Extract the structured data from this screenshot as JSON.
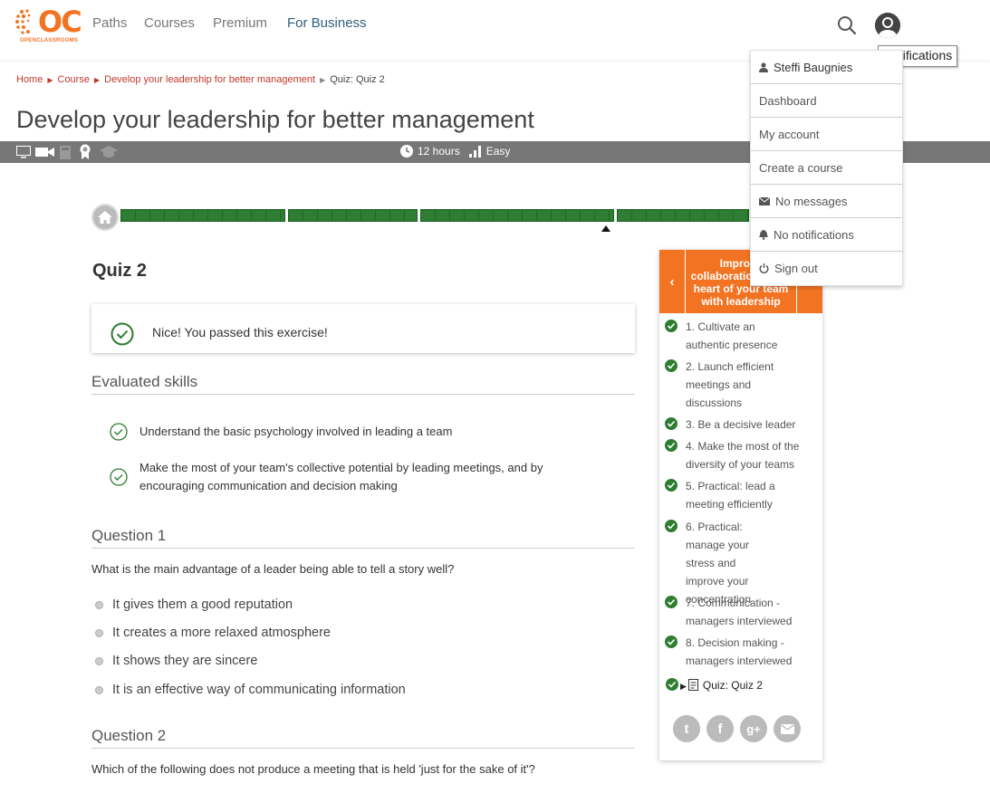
{
  "header": {
    "logo_text": "OC",
    "logo_subtext": "OPENCLASSROOMS",
    "nav": [
      "Paths",
      "Courses",
      "Premium",
      "For Business"
    ],
    "tooltip": "Notifications"
  },
  "user_menu": {
    "user_name": "Steffi Baugnies",
    "items": [
      "Dashboard",
      "My account",
      "Create a course",
      "No messages",
      "No notifications",
      "Sign out"
    ]
  },
  "breadcrumb": [
    "Home",
    "Course",
    "Develop your leadership for better management",
    "Quiz: Quiz 2"
  ],
  "course": {
    "title": "Develop your leadership for better management",
    "duration": "12 hours",
    "difficulty": "Easy"
  },
  "progress": {
    "segments": 4,
    "complete_fraction": 1.0
  },
  "quiz": {
    "title": "Quiz 2",
    "passed_message": "Nice! You passed this exercise!",
    "skills_heading": "Evaluated skills",
    "skills": [
      "Understand the basic psychology involved in leading a team",
      "Make the most of your team's collective potential by leading meetings, and by encouraging communication and decision making"
    ],
    "questions": [
      {
        "heading": "Question 1",
        "text": "What is the main advantage of a leader being able to tell a story well?",
        "options": [
          "It gives them a good reputation",
          "It creates a more relaxed atmosphere",
          "It shows they are sincere",
          "It is an effective way of communicating information"
        ]
      },
      {
        "heading": "Question 2",
        "text": "Which of the following does not produce a meeting that is held 'just for the sake of it'?"
      }
    ]
  },
  "sidebar": {
    "part_title": "Improve collaboration at the heart of your team with leadership",
    "chapters": [
      "1. Cultivate an authentic presence",
      "2. Launch efficient meetings and discussions",
      "3. Be a decisive leader",
      "4. Make the most of the diversity of your teams",
      "5. Practical: lead a meeting efficiently",
      "6. Practical: manage your stress and improve your concentration",
      "7. Communication - managers interviewed",
      "8. Decision making - managers interviewed"
    ],
    "current": "Quiz: Quiz 2",
    "share": [
      "twitter",
      "facebook",
      "google-plus",
      "email"
    ]
  },
  "colors": {
    "brand_orange": "#f27422",
    "success_green": "#2e7d32",
    "link_red": "#c0392b",
    "nav_business": "#2c5f7c"
  }
}
